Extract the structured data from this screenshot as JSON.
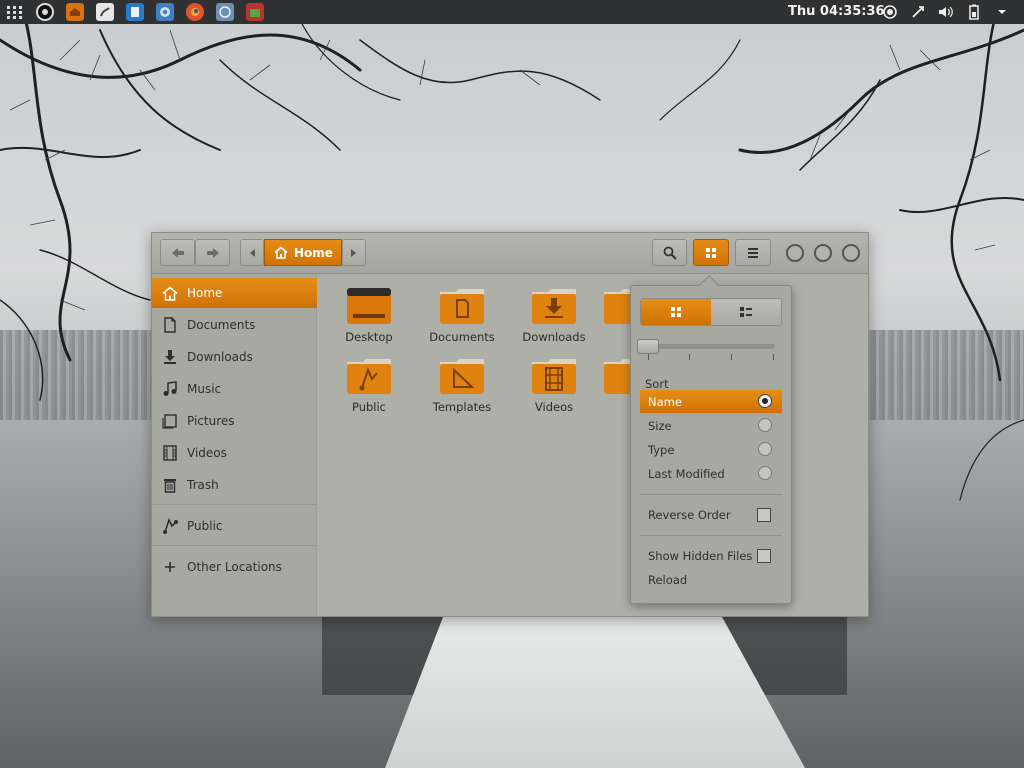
{
  "panel": {
    "clock": "Thu 04:35:36",
    "launchers": [
      "apps-grid-icon",
      "camera-app-icon",
      "home-folder-icon",
      "gimp-icon",
      "documents-icon",
      "chromium-icon",
      "firefox-icon",
      "disk-utility-icon",
      "software-store-icon"
    ],
    "tray": [
      "record-icon",
      "network-icon",
      "volume-icon",
      "battery-icon",
      "system-menu-chevron-icon"
    ]
  },
  "window": {
    "path_home": "Home",
    "sidebar": {
      "items": [
        {
          "label": "Home",
          "icon": "home-icon"
        },
        {
          "label": "Documents",
          "icon": "document-icon"
        },
        {
          "label": "Downloads",
          "icon": "download-icon"
        },
        {
          "label": "Music",
          "icon": "music-icon"
        },
        {
          "label": "Pictures",
          "icon": "picture-icon"
        },
        {
          "label": "Videos",
          "icon": "film-icon"
        },
        {
          "label": "Trash",
          "icon": "trash-icon"
        },
        {
          "label": "Public",
          "icon": "share-icon"
        },
        {
          "label": "Other Locations",
          "icon": "plus-icon"
        }
      ]
    },
    "files": [
      {
        "label": "Desktop"
      },
      {
        "label": "Documents"
      },
      {
        "label": "Downloads"
      },
      {
        "label": "Public"
      },
      {
        "label": "Templates"
      },
      {
        "label": "Videos"
      }
    ]
  },
  "popover": {
    "sort_label": "Sort",
    "sort_options": [
      {
        "label": "Name",
        "selected": true
      },
      {
        "label": "Size",
        "selected": false
      },
      {
        "label": "Type",
        "selected": false
      },
      {
        "label": "Last Modified",
        "selected": false
      }
    ],
    "reverse_order": "Reverse Order",
    "show_hidden": "Show Hidden Files",
    "reload": "Reload"
  },
  "colors": {
    "accent": "#df8210",
    "window_bg": "#aeb0a8",
    "panel_bg": "#2f3133"
  }
}
